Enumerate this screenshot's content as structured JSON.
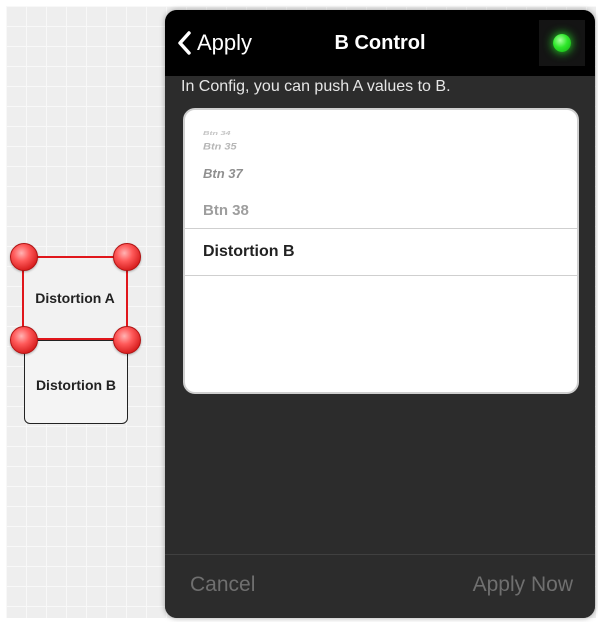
{
  "canvas": {
    "blocks": {
      "block_a": {
        "label": "Distortion A"
      },
      "block_b": {
        "label": "Distortion B"
      }
    }
  },
  "dialog": {
    "back_label": "Apply",
    "title": "B Control",
    "status_indicator": {
      "state": "on",
      "color": "#2ee82a"
    },
    "hint": "In Config, you can push A values to B.",
    "picker": {
      "items": [
        "Btn 34",
        "Btn 35",
        "Btn 37",
        "Btn 38"
      ],
      "selected": "Distortion B"
    },
    "footer": {
      "cancel_label": "Cancel",
      "apply_now_label": "Apply Now"
    }
  },
  "colors": {
    "accent_red": "#e0161b",
    "panel_bg": "#2c2c2c",
    "nav_bg": "#000000"
  }
}
